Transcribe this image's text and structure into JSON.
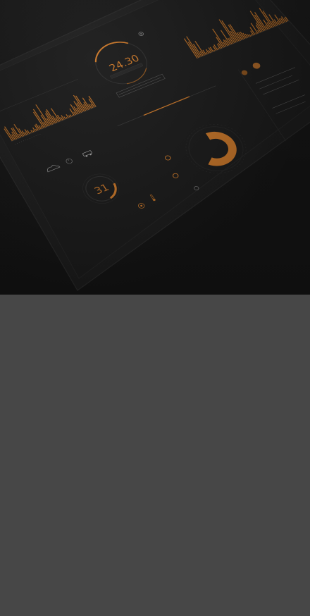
{
  "dashboard": {
    "clock": {
      "time": "24.30"
    },
    "date_dial": {
      "day": "31"
    },
    "accent_color": "#c9772a",
    "background_color": "#161616",
    "lower_background_color": "#474747"
  },
  "icons": {
    "gear": "gear-icon",
    "power": "power-icon",
    "cloud": "cloud-icon",
    "car": "car-icon",
    "lightbulb": "lightbulb-icon",
    "thermometer": "thermometer-icon",
    "bell": "bell-icon"
  }
}
